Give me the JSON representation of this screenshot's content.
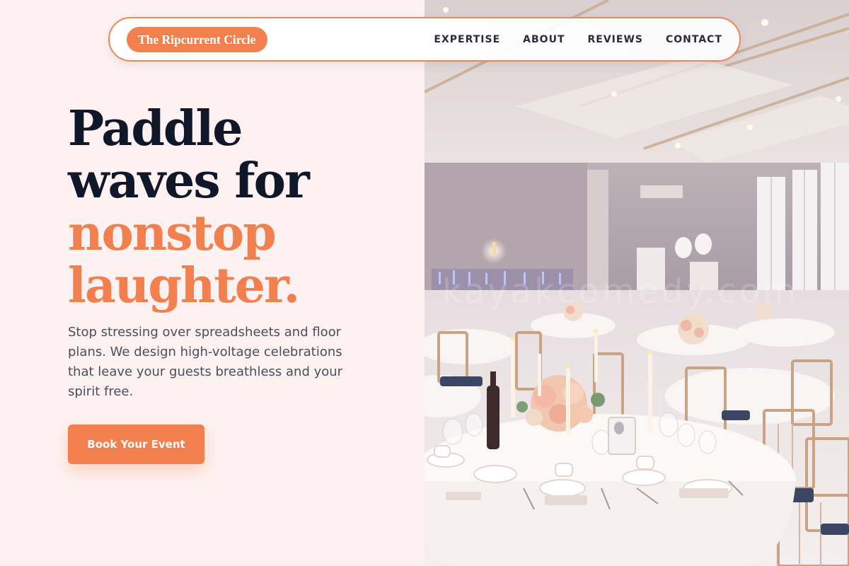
{
  "brand": {
    "name": "The Ripcurrent Circle"
  },
  "nav": {
    "items": [
      {
        "label": "EXPERTISE"
      },
      {
        "label": "ABOUT"
      },
      {
        "label": "REVIEWS"
      },
      {
        "label": "CONTACT"
      }
    ]
  },
  "hero": {
    "headline_dark_1": "Paddle",
    "headline_dark_2": "waves for",
    "headline_accent_1": "nonstop",
    "headline_accent_2": "laughter.",
    "lede": "Stop stressing over spreadsheets and floor plans. We design high-voltage celebrations that leave your guests breathless and your spirit free.",
    "cta_label": "Book Your Event"
  },
  "colors": {
    "accent": "#f2804f",
    "headline_dark": "#0f1729",
    "background": "#fdf2f1"
  },
  "photo": {
    "subject": "banquet-hall-photo"
  }
}
